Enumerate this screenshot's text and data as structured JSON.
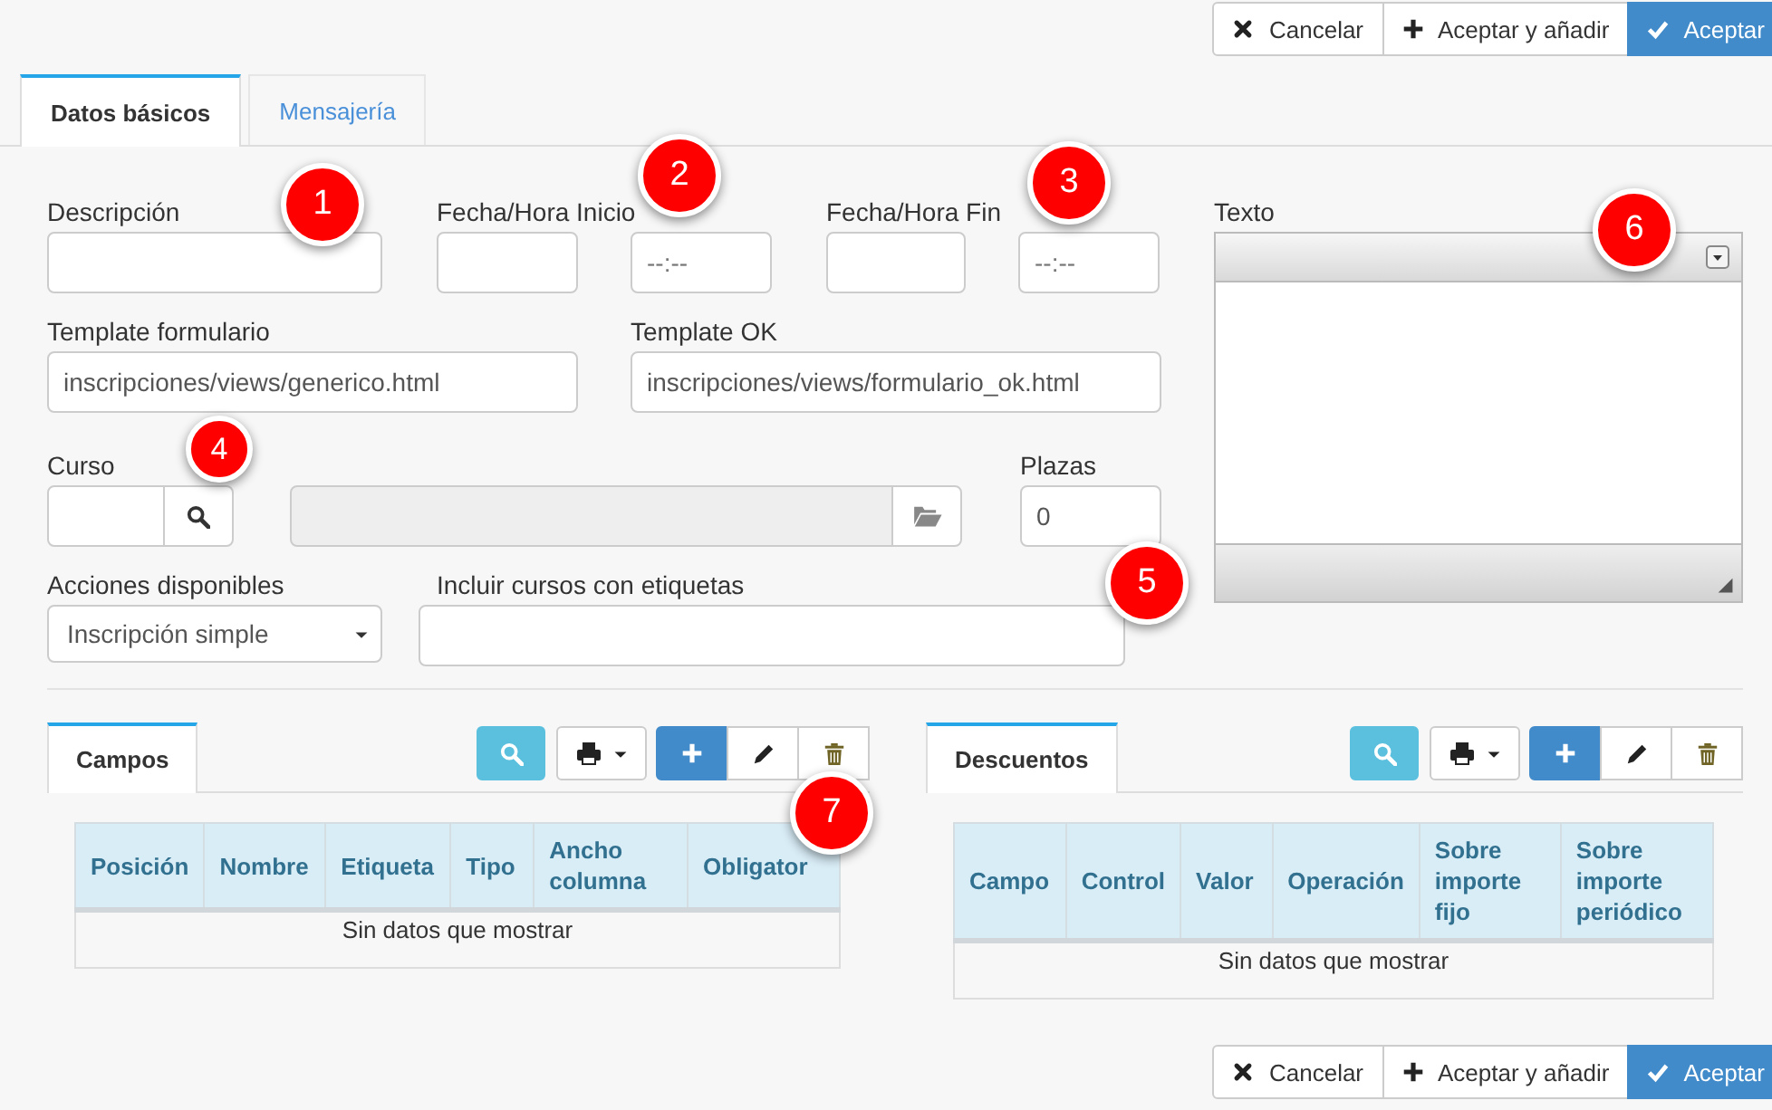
{
  "actions_top": [
    {
      "kind": "cancel",
      "label": "Cancelar"
    },
    {
      "kind": "add",
      "label": "Aceptar y añadir"
    },
    {
      "kind": "accept",
      "label": "Aceptar"
    }
  ],
  "tabs": [
    {
      "label": "Datos básicos",
      "selected": true
    },
    {
      "label": "Mensajería",
      "selected": false
    }
  ],
  "form": {
    "descripcion": {
      "label": "Descripción"
    },
    "fecha_inicio": {
      "label": "Fecha/Hora Inicio",
      "time": {
        "placeholder": "--:--"
      }
    },
    "fecha_fin": {
      "label": "Fecha/Hora Fin",
      "time": {
        "placeholder": "--:--"
      }
    },
    "template_formulario": {
      "label": "Template formulario",
      "value": "inscripciones/views/generico.html"
    },
    "template_ok": {
      "label": "Template OK",
      "value": "inscripciones/views/formulario_ok.html"
    },
    "curso": {
      "label": "Curso"
    },
    "curso_nombre": {
      "disabled": true
    },
    "plazas": {
      "label": "Plazas",
      "value": "0"
    },
    "acciones": {
      "label": "Acciones disponibles",
      "value": "Inscripción simple"
    },
    "etiquetas": {
      "label": "Incluir cursos con etiquetas"
    },
    "texto": {
      "label": "Texto"
    }
  },
  "panels": [
    {
      "tab": "Campos",
      "columns": [
        "Posición",
        "Nombre",
        "Etiqueta",
        "Tipo",
        "Ancho columna",
        "Obligator"
      ],
      "empty_message": "Sin datos que mostrar"
    },
    {
      "tab": "Descuentos",
      "columns": [
        "Campo",
        "Control",
        "Valor",
        "Operación",
        "Sobre importe fijo",
        "Sobre importe periódico"
      ],
      "empty_message": "Sin datos que mostrar"
    }
  ],
  "actions_bottom": [
    {
      "kind": "cancel",
      "label": "Cancelar"
    },
    {
      "kind": "add",
      "label": "Aceptar y añadir"
    },
    {
      "kind": "accept",
      "label": "Aceptar"
    }
  ],
  "callouts": [
    {
      "number": "1"
    },
    {
      "number": "2"
    },
    {
      "number": "3"
    },
    {
      "number": "4"
    },
    {
      "number": "5"
    },
    {
      "number": "6"
    },
    {
      "number": "7"
    }
  ]
}
